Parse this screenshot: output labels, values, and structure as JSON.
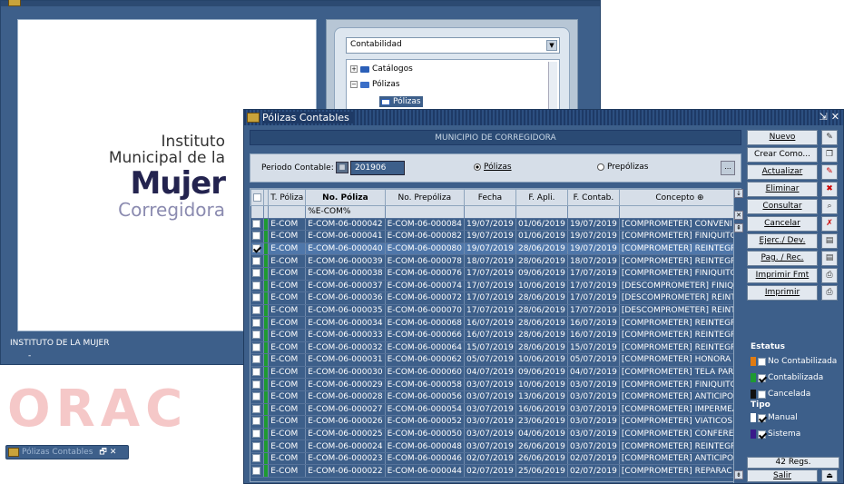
{
  "background": {
    "logo": {
      "line1": "Instituto",
      "line2": "Municipal de la",
      "line3": "Mujer",
      "line4": "Corregidora"
    },
    "status_text": "INSTITUTO DE LA MUJER",
    "status_dash": "-",
    "navigator": {
      "select_value": "Contabilidad",
      "tree": [
        {
          "label": "Catálogos",
          "expand": "+"
        },
        {
          "label": "Pólizas",
          "expand": "−"
        },
        {
          "label": "Pólizas"
        }
      ]
    },
    "watermark": "ORAC",
    "minimized_window": {
      "title": "Pólizas Contables"
    }
  },
  "window": {
    "title": "Pólizas Contables",
    "header": "MUNICIPIO DE CORREGIDORA",
    "filter": {
      "periodo_label": "Periodo Contable:",
      "periodo_value": "201906",
      "radio_polizas": "Pólizas",
      "radio_prepolizas": "Prepólizas",
      "selected": "Pólizas",
      "more_label": "..."
    },
    "grid": {
      "columns": [
        "T. Póliza",
        "No. Póliza",
        "No. Prepóliza",
        "Fecha",
        "F. Apli.",
        "F. Contab.",
        "Concepto"
      ],
      "filter_value": "%E-COM%",
      "rows": [
        {
          "tipo": "E-COM",
          "no": "E-COM-06-000042",
          "pre": "E-COM-06-000084",
          "fecha": "19/07/2019",
          "apli": "01/06/2019",
          "contab": "19/07/2019",
          "concepto": "[COMPROMETER] CONVENI",
          "checked": false
        },
        {
          "tipo": "E-COM",
          "no": "E-COM-06-000041",
          "pre": "E-COM-06-000082",
          "fecha": "19/07/2019",
          "apli": "01/06/2019",
          "contab": "19/07/2019",
          "concepto": "[COMPROMETER] FINIQUITO",
          "checked": false
        },
        {
          "tipo": "E-COM",
          "no": "E-COM-06-000040",
          "pre": "E-COM-06-000080",
          "fecha": "19/07/2019",
          "apli": "28/06/2019",
          "contab": "19/07/2019",
          "concepto": "[COMPROMETER] REINTEGR",
          "checked": true
        },
        {
          "tipo": "E-COM",
          "no": "E-COM-06-000039",
          "pre": "E-COM-06-000078",
          "fecha": "18/07/2019",
          "apli": "28/06/2019",
          "contab": "18/07/2019",
          "concepto": "[COMPROMETER] REINTEGR",
          "checked": false
        },
        {
          "tipo": "E-COM",
          "no": "E-COM-06-000038",
          "pre": "E-COM-06-000076",
          "fecha": "17/07/2019",
          "apli": "09/06/2019",
          "contab": "17/07/2019",
          "concepto": "[COMPROMETER] FINIQUITO",
          "checked": false
        },
        {
          "tipo": "E-COM",
          "no": "E-COM-06-000037",
          "pre": "E-COM-06-000074",
          "fecha": "17/07/2019",
          "apli": "10/06/2019",
          "contab": "17/07/2019",
          "concepto": "[DESCOMPROMETER] FINIQ",
          "checked": false
        },
        {
          "tipo": "E-COM",
          "no": "E-COM-06-000036",
          "pre": "E-COM-06-000072",
          "fecha": "17/07/2019",
          "apli": "28/06/2019",
          "contab": "17/07/2019",
          "concepto": "[DESCOMPROMETER] REINT",
          "checked": false
        },
        {
          "tipo": "E-COM",
          "no": "E-COM-06-000035",
          "pre": "E-COM-06-000070",
          "fecha": "17/07/2019",
          "apli": "28/06/2019",
          "contab": "17/07/2019",
          "concepto": "[DESCOMPROMETER] REINT",
          "checked": false
        },
        {
          "tipo": "E-COM",
          "no": "E-COM-06-000034",
          "pre": "E-COM-06-000068",
          "fecha": "16/07/2019",
          "apli": "28/06/2019",
          "contab": "16/07/2019",
          "concepto": "[COMPROMETER] REINTEGR",
          "checked": false
        },
        {
          "tipo": "E-COM",
          "no": "E-COM-06-000033",
          "pre": "E-COM-06-000066",
          "fecha": "16/07/2019",
          "apli": "28/06/2019",
          "contab": "16/07/2019",
          "concepto": "[COMPROMETER] REINTEGR",
          "checked": false
        },
        {
          "tipo": "E-COM",
          "no": "E-COM-06-000032",
          "pre": "E-COM-06-000064",
          "fecha": "15/07/2019",
          "apli": "28/06/2019",
          "contab": "15/07/2019",
          "concepto": "[COMPROMETER] REINTEGR",
          "checked": false
        },
        {
          "tipo": "E-COM",
          "no": "E-COM-06-000031",
          "pre": "E-COM-06-000062",
          "fecha": "05/07/2019",
          "apli": "10/06/2019",
          "contab": "05/07/2019",
          "concepto": "[COMPROMETER] HONORA",
          "checked": false
        },
        {
          "tipo": "E-COM",
          "no": "E-COM-06-000030",
          "pre": "E-COM-06-000060",
          "fecha": "04/07/2019",
          "apli": "09/06/2019",
          "contab": "04/07/2019",
          "concepto": "[COMPROMETER] TELA PAR",
          "checked": false
        },
        {
          "tipo": "E-COM",
          "no": "E-COM-06-000029",
          "pre": "E-COM-06-000058",
          "fecha": "03/07/2019",
          "apli": "10/06/2019",
          "contab": "03/07/2019",
          "concepto": "[COMPROMETER] FINIQUITO",
          "checked": false
        },
        {
          "tipo": "E-COM",
          "no": "E-COM-06-000028",
          "pre": "E-COM-06-000056",
          "fecha": "03/07/2019",
          "apli": "13/06/2019",
          "contab": "03/07/2019",
          "concepto": "[COMPROMETER] ANTICIPO",
          "checked": false
        },
        {
          "tipo": "E-COM",
          "no": "E-COM-06-000027",
          "pre": "E-COM-06-000054",
          "fecha": "03/07/2019",
          "apli": "16/06/2019",
          "contab": "03/07/2019",
          "concepto": "[COMPROMETER] IMPERMEA",
          "checked": false
        },
        {
          "tipo": "E-COM",
          "no": "E-COM-06-000026",
          "pre": "E-COM-06-000052",
          "fecha": "03/07/2019",
          "apli": "23/06/2019",
          "contab": "03/07/2019",
          "concepto": "[COMPROMETER] VIATICOS",
          "checked": false
        },
        {
          "tipo": "E-COM",
          "no": "E-COM-06-000025",
          "pre": "E-COM-06-000050",
          "fecha": "03/07/2019",
          "apli": "04/06/2019",
          "contab": "03/07/2019",
          "concepto": "[COMPROMETER] CONFERE",
          "checked": false
        },
        {
          "tipo": "E-COM",
          "no": "E-COM-06-000024",
          "pre": "E-COM-06-000048",
          "fecha": "03/07/2019",
          "apli": "26/06/2019",
          "contab": "03/07/2019",
          "concepto": "[COMPROMETER] REINTEGR",
          "checked": false
        },
        {
          "tipo": "E-COM",
          "no": "E-COM-06-000023",
          "pre": "E-COM-06-000046",
          "fecha": "02/07/2019",
          "apli": "26/06/2019",
          "contab": "02/07/2019",
          "concepto": "[COMPROMETER] ANTICIPO",
          "checked": false
        },
        {
          "tipo": "E-COM",
          "no": "E-COM-06-000022",
          "pre": "E-COM-06-000044",
          "fecha": "02/07/2019",
          "apli": "25/06/2019",
          "contab": "02/07/2019",
          "concepto": "[COMPROMETER] REPARAC",
          "checked": false
        }
      ],
      "selected_row": 2
    },
    "buttons": [
      {
        "label": "Nuevo",
        "name": "nuevo"
      },
      {
        "label": "Crear Como...",
        "name": "crear-como"
      },
      {
        "label": "Actualizar",
        "name": "actualizar"
      },
      {
        "label": "Eliminar",
        "name": "eliminar"
      },
      {
        "label": "Consultar",
        "name": "consultar"
      },
      {
        "label": "Cancelar",
        "name": "cancelar"
      },
      {
        "label": "Ejerc./ Dev.",
        "name": "ejerc-dev"
      },
      {
        "label": "Pag. / Rec.",
        "name": "pag-rec"
      },
      {
        "label": "Imprimir Fmt",
        "name": "imprimir-fmt"
      },
      {
        "label": "Imprimir",
        "name": "imprimir"
      }
    ],
    "estatus": {
      "title": "Estatus",
      "items": [
        {
          "label": "No Contabilizada",
          "color": "#e07b12",
          "checked": false
        },
        {
          "label": "Contabilizada",
          "color": "#1e9a32",
          "checked": true
        },
        {
          "label": "Cancelada",
          "color": "#111111",
          "checked": false
        }
      ]
    },
    "tipo": {
      "title": "Tipo",
      "items": [
        {
          "label": "Manual",
          "color": "#ffffff",
          "checked": true
        },
        {
          "label": "Sistema",
          "color": "#3a1a8a",
          "checked": true
        }
      ]
    },
    "regs": "42 Regs.",
    "salir": "Salir"
  }
}
